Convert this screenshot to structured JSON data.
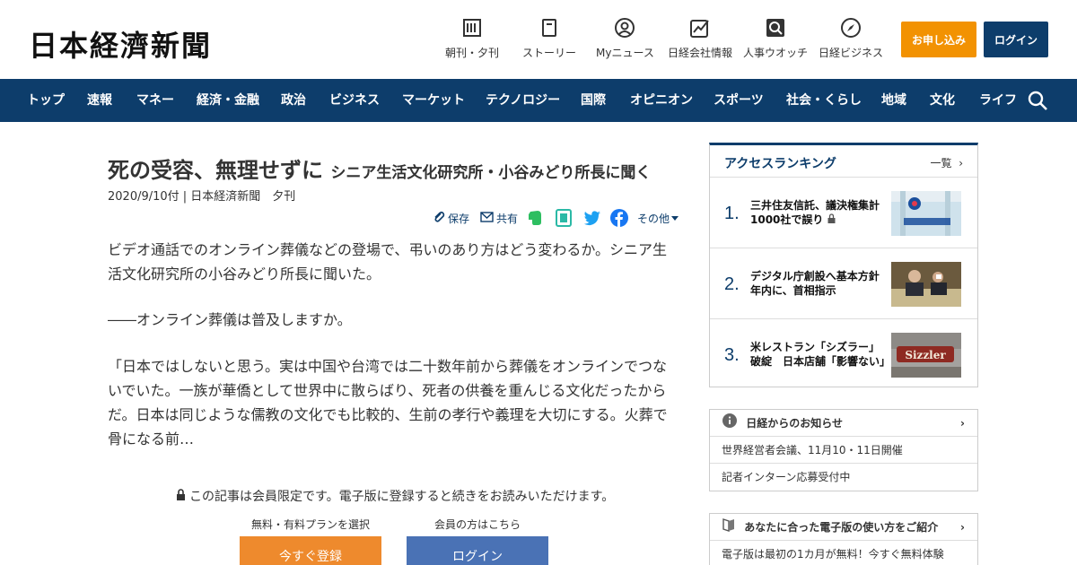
{
  "header": {
    "logo": "日本経濟新聞",
    "nav": [
      {
        "label": "朝刊・夕刊",
        "icon": "newspaper-icon"
      },
      {
        "label": "ストーリー",
        "icon": "document-icon"
      },
      {
        "label": "Myニュース",
        "icon": "user-icon"
      },
      {
        "label": "日経会社情報",
        "icon": "chart-icon"
      },
      {
        "label": "人事ウオッチ",
        "icon": "search-person-icon"
      },
      {
        "label": "日経ビジネス",
        "icon": "compass-icon"
      }
    ],
    "apply_label": "お申し込み",
    "login_label": "ログイン"
  },
  "navbar": {
    "items": [
      "トップ",
      "速報",
      "マネー",
      "経済・金融",
      "政治",
      "ビジネス",
      "マーケット",
      "テクノロジー",
      "国際",
      "オピニオン",
      "スポーツ",
      "社会・くらし",
      "地域",
      "文化",
      "ライフ"
    ],
    "search_icon": "search-icon"
  },
  "article": {
    "title": "死の受容、無理せずに",
    "subtitle": "シニア生活文化研究所・小谷みどり所長に聞く",
    "meta": "2020/9/10付 | 日本経済新聞　夕刊",
    "share": {
      "save": "保存",
      "share": "共有",
      "more": "その他"
    },
    "paragraphs": [
      "ビデオ通話でのオンライン葬儀などの登場で、弔いのあり方はどう変わるか。シニア生活文化研究所の小谷みどり所長に聞いた。",
      "――オンライン葬儀は普及しますか。",
      "「日本ではしないと思う。実は中国や台湾では二十数年前から葬儀をオンラインでつないでいた。一族が華僑として世界中に散らばり、死者の供養を重んじる文化だったからだ。日本は同じような儒教の文化でも比較的、生前の孝行や義理を大切にする。火葬で骨になる前…"
    ],
    "paywall_msg": "この記事は会員限定です。電子版に登録すると続きをお読みいただけます。",
    "plan_label": "無料・有料プランを選択",
    "member_label": "会員の方はこちら",
    "register_btn": "今すぐ登録",
    "login_btn": "ログイン"
  },
  "ranking": {
    "title": "アクセスランキング",
    "more": "一覧",
    "items": [
      {
        "num": "1.",
        "text": "三井住友信託、議決権集計1000社で誤り"
      },
      {
        "num": "2.",
        "text": "デジタル庁創設へ基本方針　年内に、首相指示"
      },
      {
        "num": "3.",
        "text": "米レストラン「シズラー」破綻　日本店舗「影響ない」"
      }
    ]
  },
  "notice": {
    "title": "日経からのお知らせ",
    "items": [
      "世界経営者会議、11月10・11日開催",
      "記者インターン応募受付中"
    ]
  },
  "guide": {
    "title": "あなたに合った電子版の使い方をご紹介",
    "item": "電子版は最初の1カ月が無料！今すぐ無料体験"
  },
  "colors": {
    "navy": "#0d3d6b",
    "orange": "#f29202",
    "blue_btn": "#4a72b5"
  }
}
